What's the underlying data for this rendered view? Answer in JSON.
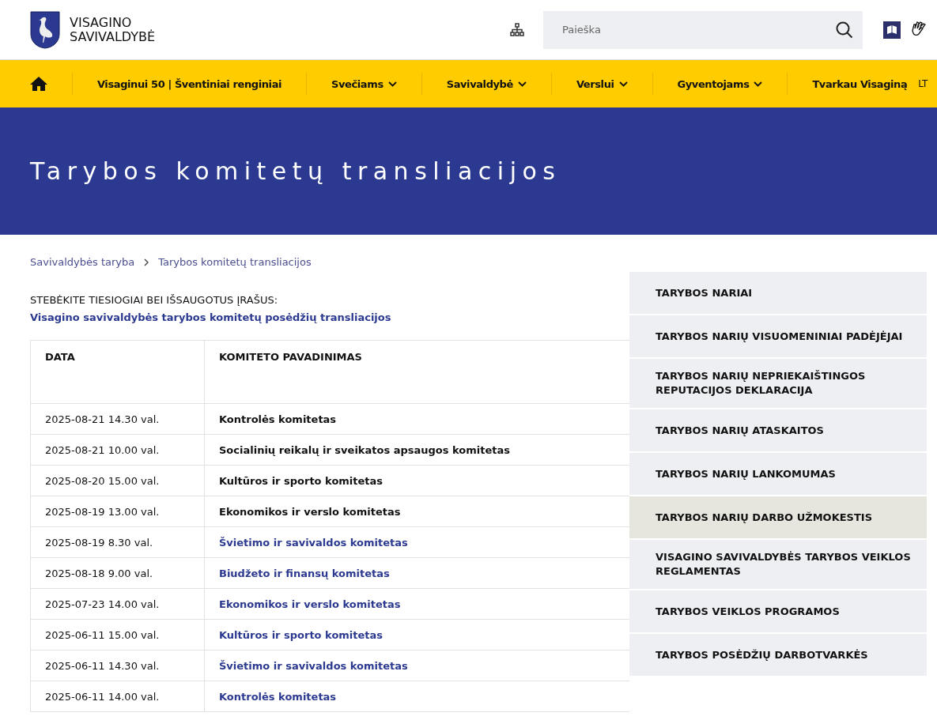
{
  "header": {
    "site_name_line1": "VISAGINO",
    "site_name_line2": "SAVIVALDYBĖ",
    "search": {
      "placeholder": "Paieška"
    }
  },
  "nav": {
    "items": [
      {
        "label": "Visaginui 50 | Šventiniai renginiai",
        "dropdown": false
      },
      {
        "label": "Svečiams",
        "dropdown": true
      },
      {
        "label": "Savivaldybė",
        "dropdown": true
      },
      {
        "label": "Verslui",
        "dropdown": true
      },
      {
        "label": "Gyventojams",
        "dropdown": true
      },
      {
        "label": "Tvarkau Visaginą",
        "dropdown": false
      }
    ],
    "language": "LT"
  },
  "banner": {
    "title": "Tarybos komitetų transliacijos"
  },
  "breadcrumbs": [
    "Savivaldybės taryba",
    "Tarybos komitetų transliacijos"
  ],
  "intro": {
    "text": "STEBĖKITE TIESIOGIAI BEI IŠSAUGOTUS ĮRAŠUS:",
    "link": "Visagino savivaldybės tarybos komitetų posėdžių transliacijos"
  },
  "table": {
    "columns": [
      "DATA",
      "KOMITETO PAVADINIMAS"
    ],
    "rows": [
      {
        "date": "2025-08-21 14.30 val.",
        "name": "Kontrolės komitetas",
        "kind": "text"
      },
      {
        "date": "2025-08-21 10.00 val.",
        "name": "Socialinių reikalų ir sveikatos apsaugos komitetas",
        "kind": "text"
      },
      {
        "date": "2025-08-20 15.00 val.",
        "name": "Kultūros ir sporto komitetas",
        "kind": "text"
      },
      {
        "date": "2025-08-19 13.00 val.",
        "name": "Ekonomikos ir verslo komitetas",
        "kind": "text"
      },
      {
        "date": "2025-08-19 8.30 val.",
        "name": "Švietimo ir savivaldos komitetas",
        "kind": "link"
      },
      {
        "date": "2025-08-18 9.00 val.",
        "name": "Biudžeto ir finansų komitetas",
        "kind": "link"
      },
      {
        "date": "2025-07-23 14.00 val.",
        "name": "Ekonomikos ir verslo komitetas",
        "kind": "link"
      },
      {
        "date": "2025-06-11 15.00 val.",
        "name": "Kultūros ir sporto komitetas",
        "kind": "link"
      },
      {
        "date": "2025-06-11 14.30 val.",
        "name": "Švietimo ir savivaldos komitetas",
        "kind": "link"
      },
      {
        "date": "2025-06-11 14.00 val.",
        "name": "Kontrolės komitetas",
        "kind": "link"
      }
    ]
  },
  "sidebar": {
    "items": [
      {
        "label": "TARYBOS NARIAI",
        "selected": false
      },
      {
        "label": "TARYBOS NARIŲ VISUOMENINIAI PADĖJĖJAI",
        "selected": false
      },
      {
        "label": "TARYBOS NARIŲ NEPRIEKAIŠTINGOS REPUTACIJOS DEKLARACIJA",
        "selected": false
      },
      {
        "label": "TARYBOS NARIŲ ATASKAITOS",
        "selected": false
      },
      {
        "label": "TARYBOS NARIŲ LANKOMUMAS",
        "selected": false
      },
      {
        "label": "TARYBOS NARIŲ DARBO UŽMOKESTIS",
        "selected": true
      },
      {
        "label": "VISAGINO SAVIVALDYBĖS TARYBOS VEIKLOS REGLAMENTAS",
        "selected": false
      },
      {
        "label": "TARYBOS VEIKLOS PROGRAMOS",
        "selected": false
      },
      {
        "label": "TARYBOS POSĖDŽIŲ DARBOTVARKĖS",
        "selected": false
      }
    ]
  }
}
